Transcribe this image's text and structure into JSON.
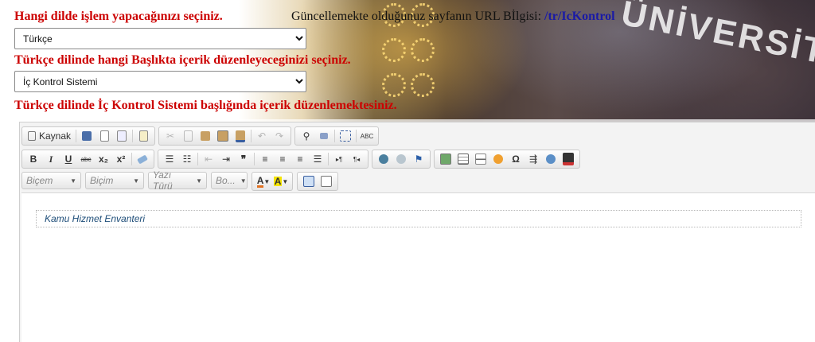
{
  "labels": {
    "language_prompt": "Hangi dilde işlem yapacağınızı seçiniz.",
    "heading_prompt": "Türkçe dilinde hangi Başlıkta içerik düzenleyeceginizi seçiniz.",
    "editing_status": "Türkçe dilinde İç Kontrol Sistemi başlığında içerik düzenlemektesiniz."
  },
  "url_info": {
    "label": "Güncellemekte olduğunuz sayfanın URL Bİlgisi:",
    "value": "/tr/IcKontrol"
  },
  "language_select": {
    "value": "Türkçe"
  },
  "heading_select": {
    "value": "İç Kontrol Sistemi"
  },
  "background_sign_text": "ÜNİVERSİTESİ",
  "toolbar": {
    "source_label": "Kaynak",
    "bold": "B",
    "italic": "I",
    "underline": "U",
    "strike": "abc",
    "subscript": "x₂",
    "superscript": "x²",
    "quote": "❞",
    "spell": "ABC",
    "combo_style": "Biçem",
    "combo_format": "Biçim",
    "combo_font": "Yazı Türü",
    "combo_size": "Bo...",
    "text_color": "A",
    "bg_color": "A"
  },
  "editor": {
    "content": "Kamu Hizmet Envanteri"
  },
  "colors": {
    "label_red": "#cc0000",
    "url_blue": "#1a1aa6",
    "editor_text": "#1f4e79"
  }
}
